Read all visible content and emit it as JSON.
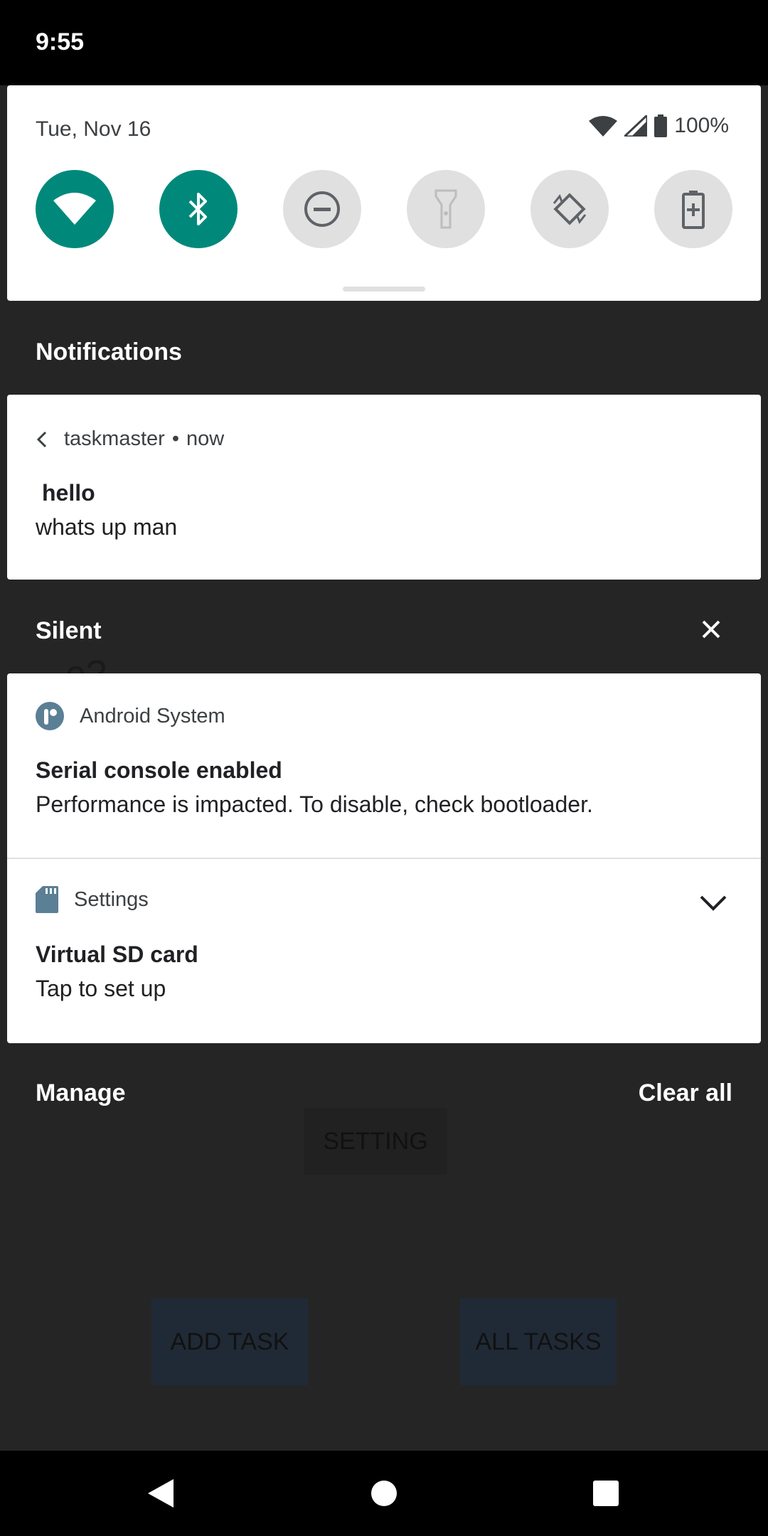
{
  "status_bar": {
    "time": "9:55"
  },
  "quick_settings": {
    "date": "Tue, Nov 16",
    "battery_percent": "100%",
    "tiles": [
      {
        "name": "wifi",
        "state": "on"
      },
      {
        "name": "bluetooth",
        "state": "on"
      },
      {
        "name": "do-not-disturb",
        "state": "off"
      },
      {
        "name": "flashlight",
        "state": "off"
      },
      {
        "name": "auto-rotate",
        "state": "off"
      },
      {
        "name": "battery-saver",
        "state": "off"
      }
    ],
    "accent_color": "#00897b"
  },
  "notifications": {
    "header": "Notifications",
    "items": [
      {
        "app": "taskmaster",
        "separator": "•",
        "time": "now",
        "title": "hello",
        "text": "whats up man"
      }
    ]
  },
  "silent": {
    "header": "Silent",
    "items": [
      {
        "app": "Android System",
        "title": "Serial console enabled",
        "text": "Performance is impacted. To disable, check bootloader."
      },
      {
        "app": "Settings",
        "title": "Virtual SD card",
        "text": "Tap to set up"
      }
    ]
  },
  "footer": {
    "manage": "Manage",
    "clear_all": "Clear all"
  },
  "background_app": {
    "partial_text": "e?",
    "setting_button": "SETTING",
    "add_task_button": "ADD TASK",
    "all_tasks_button": "ALL TASKS"
  }
}
